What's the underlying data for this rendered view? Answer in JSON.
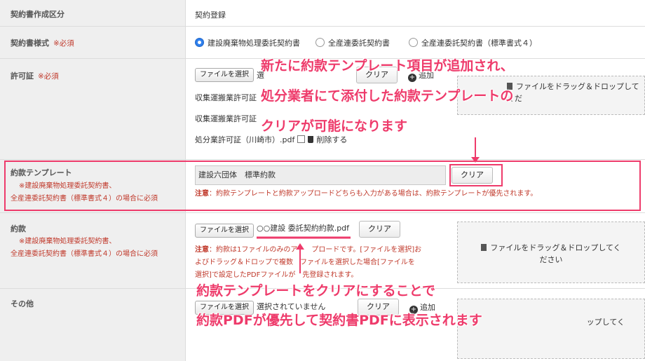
{
  "rows": {
    "type": {
      "label": "契約書作成区分",
      "value": "契約登録"
    },
    "style": {
      "label": "契約書様式",
      "required": "※必須",
      "options": [
        "建設廃棄物処理委託契約書",
        "全産連委託契約書",
        "全産連委託契約書（標準書式４）"
      ]
    },
    "permit": {
      "label": "許可証",
      "required": "※必須",
      "file_button": "ファイルを選択",
      "file_name": "選",
      "clear": "クリア",
      "add": "追加",
      "items": [
        "収集運搬業許可証",
        "収集運搬業許可証"
      ],
      "item3": "処分業許可証（川崎市）.pdf",
      "delete": "削除する",
      "drop_text": "ファイルをドラッグ＆ドロップしてくだ"
    },
    "template": {
      "label": "約款テンプレート",
      "sub1": "※建設廃棄物処理委託契約書、",
      "sub2": "全産連委託契約書（標準書式４）の場合に必須",
      "value": "建設六団体　標準約款",
      "clear": "クリア",
      "note_head": "注意",
      "note_body": "：約款テンプレートと約款アップロードどちらも入力がある場合は、約款テンプレートが優先されます。"
    },
    "terms": {
      "label": "約款",
      "sub1": "※建設廃棄物処理委託契約書、",
      "sub2": "全産連委託契約書（標準書式４）の場合に必須",
      "file_button": "ファイルを選択",
      "file_name": "○○建設 委託契約約款.pdf",
      "clear": "クリア",
      "drop_line1": "ファイルをドラッグ＆ドロップしてく",
      "drop_line2": "ださい",
      "note_head": "注意",
      "note_l1": "：約款は1ファイルのみのア　　プロードです。[ファイルを選択]お",
      "note_l2": "よびドラッグ＆ドロップで複数　ファイルを選択した場合[ファイルを",
      "note_l3": "選択]で設定したPDFファイルが　先登録されます。"
    },
    "other": {
      "label": "その他",
      "file_button": "ファイルを選択",
      "file_name": "選択されていません",
      "clear": "クリア",
      "add": "追加",
      "drop_text": "ップしてく"
    }
  },
  "callouts": {
    "top_l1": "新たに約款テンプレート項目が追加され、",
    "top_l2": "処分業者にて添付した約款テンプレートの",
    "top_l3": "クリアが可能になります",
    "bottom_l1": "約款テンプレートをクリアにすることで",
    "bottom_l2": "約款PDFが優先して契約書PDFに表示されます"
  },
  "colors": {
    "accent": "#ee3b6b",
    "radio": "#2f80ed",
    "required": "#c0392b"
  }
}
